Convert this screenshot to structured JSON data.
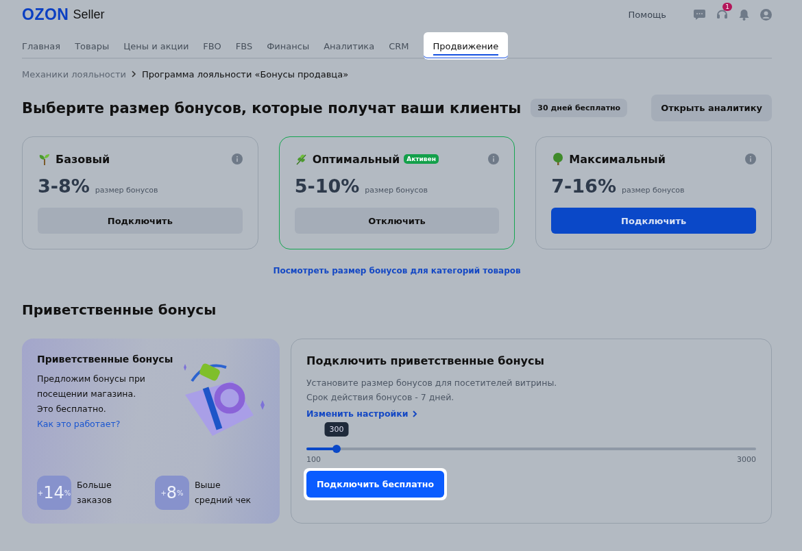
{
  "header": {
    "logo": "OZON",
    "logo_suffix": "Seller",
    "help": "Помощь",
    "support_badge": "1"
  },
  "tabs": [
    {
      "label": "Главная",
      "selected": false
    },
    {
      "label": "Товары",
      "selected": false
    },
    {
      "label": "Цены и акции",
      "selected": false
    },
    {
      "label": "FBO",
      "selected": false
    },
    {
      "label": "FBS",
      "selected": false
    },
    {
      "label": "Финансы",
      "selected": false
    },
    {
      "label": "Аналитика",
      "selected": false
    },
    {
      "label": "CRM",
      "selected": false
    },
    {
      "label": "Продвижение",
      "selected": true
    }
  ],
  "breadcrumbs": [
    "Механики лояльности",
    "Программа лояльности «Бонусы продавца»"
  ],
  "title": "Выберите размер бонусов, которые получат ваши клиенты",
  "title_badge": "30 дней бесплатно",
  "analytics_button": "Открыть аналитику",
  "plans": [
    {
      "kind": "sprout",
      "name": "Базовый",
      "range": "3-8%",
      "range_label": "размер бонусов",
      "button": "Подключить",
      "primary": false,
      "selected": false
    },
    {
      "kind": "herb",
      "name": "Оптимальный",
      "badge": "Активен",
      "range": "5-10%",
      "range_label": "размер бонусов",
      "button": "Отключить",
      "primary": false,
      "selected": true
    },
    {
      "kind": "tree",
      "name": "Максимальный",
      "range": "7-16%",
      "range_label": "размер бонусов",
      "button": "Подключить",
      "primary": true,
      "selected": false
    }
  ],
  "categories_link": "Посмотреть размер бонусов для категорий товаров",
  "welcome_title": "Приветственные бонусы",
  "promo": {
    "title": "Приветственные бонусы",
    "text": [
      "Предложим бонусы при",
      "посещении магазина.",
      "Это бесплатно."
    ],
    "link": "Как это работает?",
    "stats": [
      {
        "plus": "+",
        "value": "14",
        "unit": "%",
        "label": [
          "Больше",
          "заказов"
        ]
      },
      {
        "plus": "+",
        "value": "8",
        "unit": "%",
        "label": [
          "Выше",
          "средний чек"
        ]
      }
    ]
  },
  "connect": {
    "title": "Подключить приветственные бонусы",
    "text": [
      "Установите размер бонусов для посетителей витрины.",
      "Срок действия бонусов - 7 дней."
    ],
    "settings_link": "Изменить настройки",
    "slider": {
      "tooltip": "300",
      "level": 0.067,
      "min": "100",
      "max": "3000"
    },
    "button": "Подключить бесплатно"
  }
}
